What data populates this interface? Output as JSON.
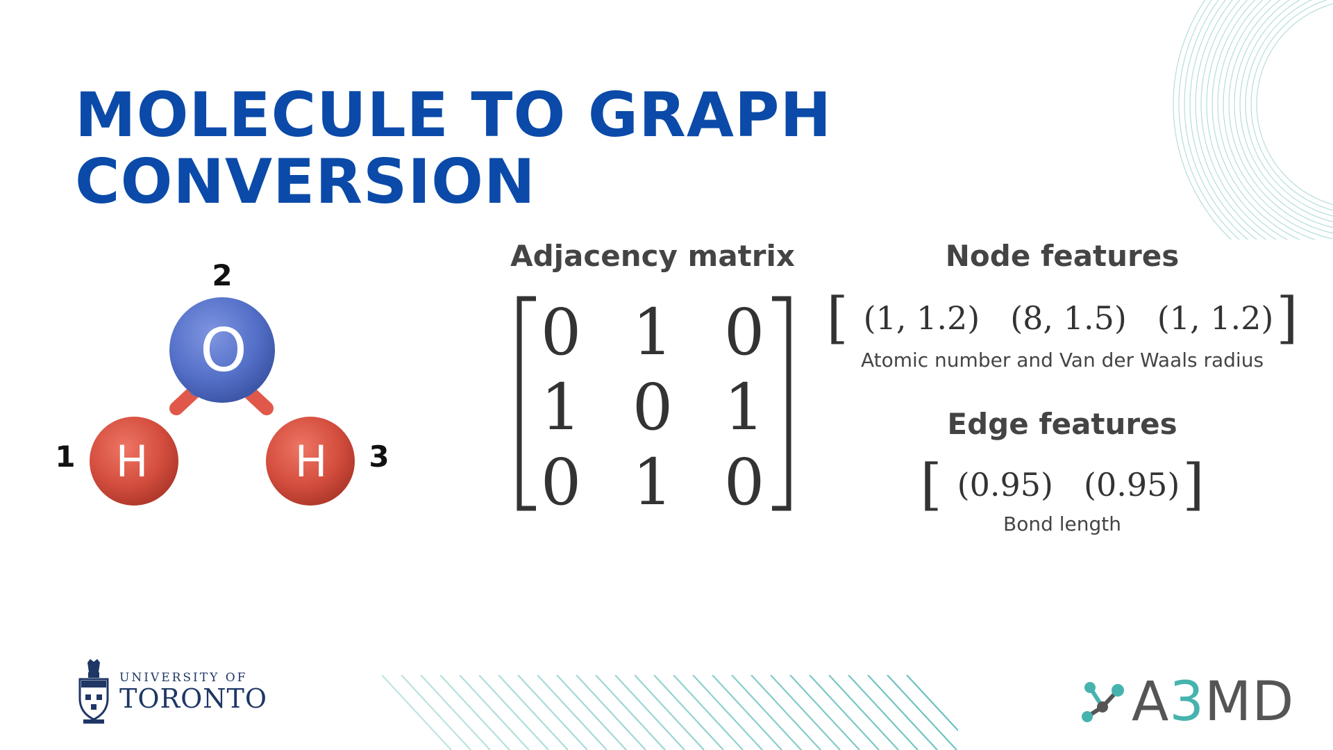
{
  "title": {
    "line1": "MOLECULE TO GRAPH",
    "line2": "CONVERSION"
  },
  "colors": {
    "title": "#0b4aa8",
    "oxygen": "#5470c8",
    "hydrogen": "#d44e3e",
    "accent": "#47b3ae",
    "text": "#444444"
  },
  "molecule": {
    "atoms": [
      {
        "index": "1",
        "symbol": "H"
      },
      {
        "index": "2",
        "symbol": "O"
      },
      {
        "index": "3",
        "symbol": "H"
      }
    ]
  },
  "adjacency": {
    "title": "Adjacency matrix",
    "rows": [
      [
        "0",
        "1",
        "0"
      ],
      [
        "1",
        "0",
        "1"
      ],
      [
        "0",
        "1",
        "0"
      ]
    ]
  },
  "node_features": {
    "title": "Node features",
    "entries": [
      "(1, 1.2)",
      "(8, 1.5)",
      "(1, 1.2)"
    ],
    "caption": "Atomic number and Van der Waals radius"
  },
  "edge_features": {
    "title": "Edge features",
    "entries": [
      "(0.95)",
      "(0.95)"
    ],
    "caption": "Bond length"
  },
  "logos": {
    "uoft_line1": "UNIVERSITY OF",
    "uoft_line2": "TORONTO",
    "a3md_prefix": "A",
    "a3md_accent": "3",
    "a3md_suffix": "MD"
  }
}
